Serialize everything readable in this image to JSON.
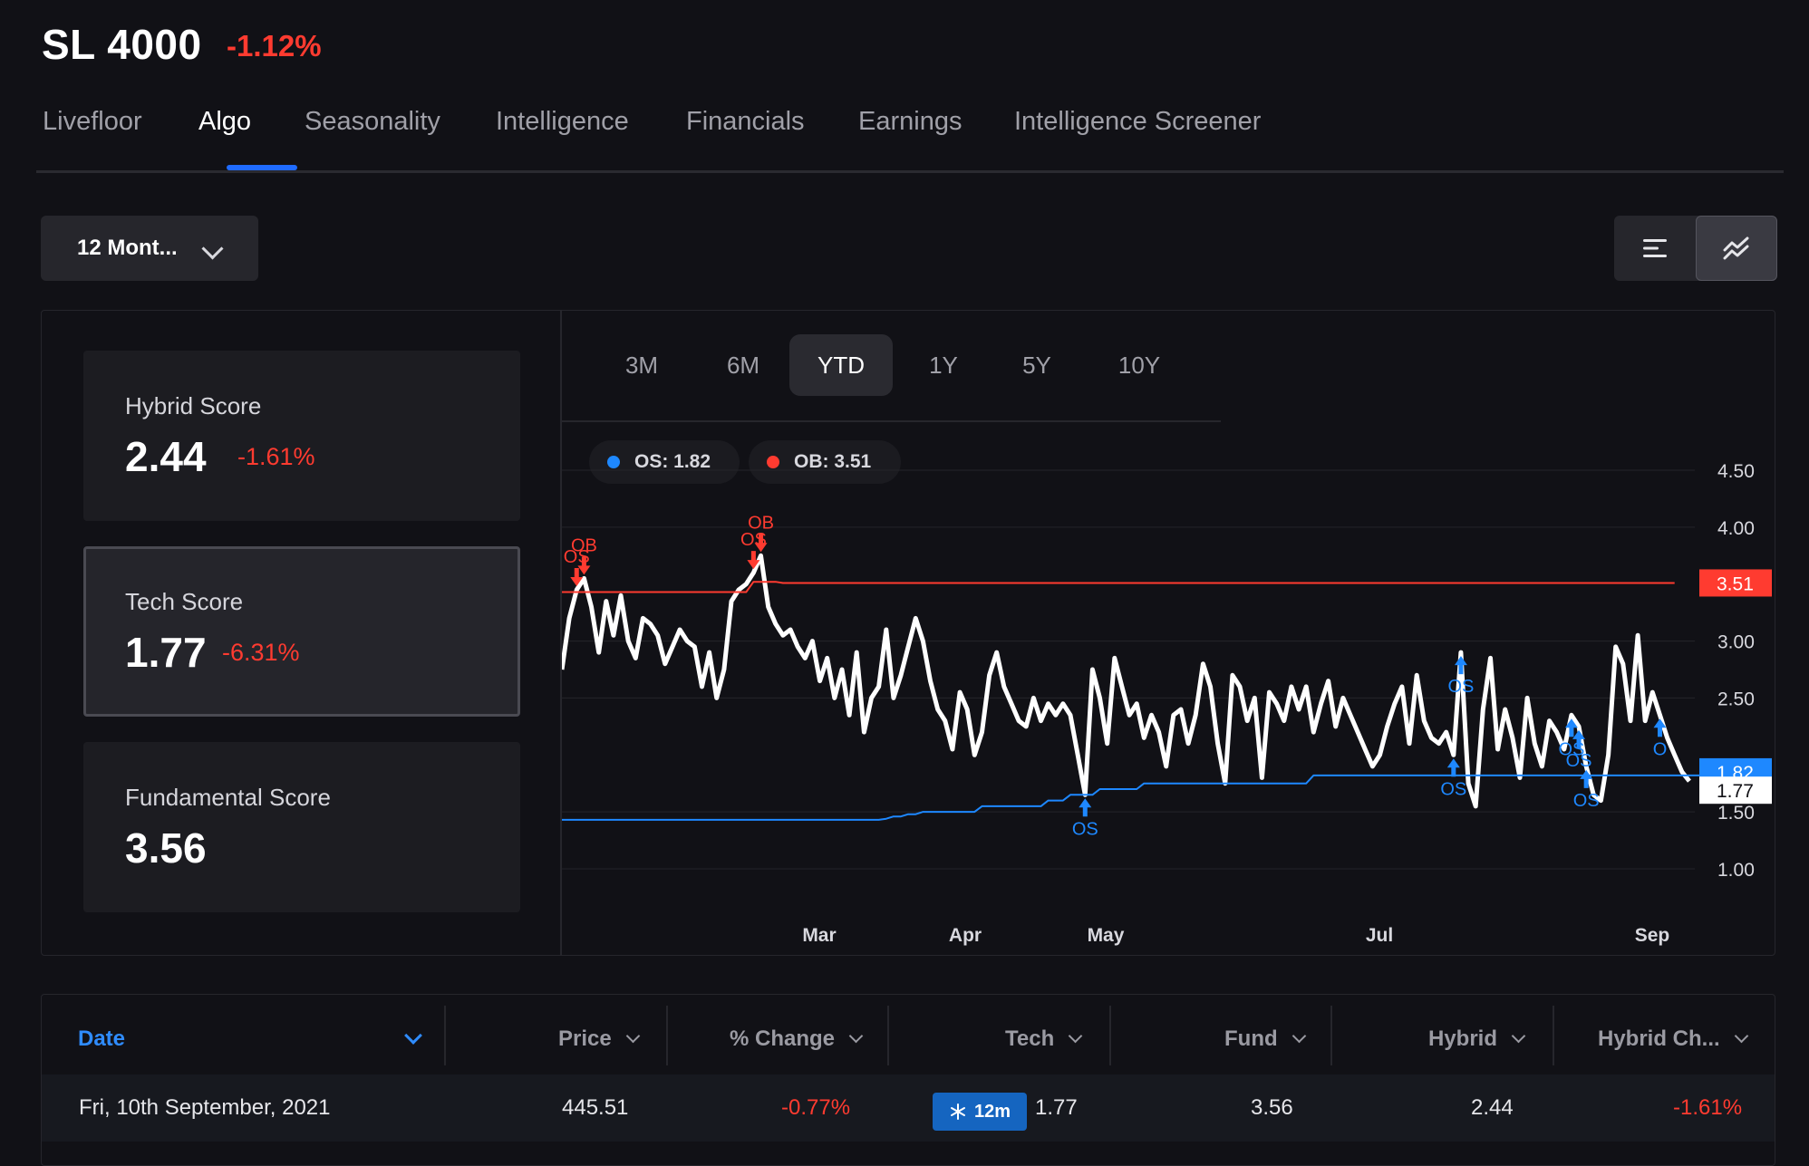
{
  "header": {
    "ticker": "SL 4000",
    "change": "-1.12%"
  },
  "tabs": [
    "Livefloor",
    "Algo",
    "Seasonality",
    "Intelligence",
    "Financials",
    "Earnings",
    "Intelligence Screener"
  ],
  "active_tab": "Algo",
  "period_select": {
    "value": "12 Mont..."
  },
  "view_toggle": {
    "icons": [
      "list-icon",
      "trend-chart-icon"
    ],
    "active": "trend-chart-icon"
  },
  "scores": [
    {
      "label": "Hybrid Score",
      "value": "2.44",
      "change": "-1.61%"
    },
    {
      "label": "Tech Score",
      "value": "1.77",
      "change": "-6.31%"
    },
    {
      "label": "Fundamental Score",
      "value": "3.56",
      "change": ""
    }
  ],
  "range_tabs": [
    "3M",
    "6M",
    "YTD",
    "1Y",
    "5Y",
    "10Y"
  ],
  "active_range": "YTD",
  "legend": [
    {
      "label": "OS: 1.82",
      "color": "#1e88ff"
    },
    {
      "label": "OB: 3.51",
      "color": "#ff3b30"
    }
  ],
  "chart_data": {
    "type": "line",
    "x_ticks": [
      "Mar",
      "Apr",
      "May",
      "Jul",
      "Sep"
    ],
    "y_ticks": [
      "4.50",
      "4.00",
      "3.00",
      "2.50",
      "1.50",
      "1.00"
    ],
    "ylim": [
      0.8,
      4.7
    ],
    "grid": true,
    "series": [
      {
        "role": "score",
        "color": "#ffffff",
        "values": [
          2.75,
          3.2,
          3.45,
          3.55,
          3.3,
          2.9,
          3.35,
          3.05,
          3.4,
          3.0,
          2.85,
          3.2,
          3.15,
          3.05,
          2.8,
          2.95,
          3.1,
          3.0,
          2.95,
          2.6,
          2.9,
          2.5,
          2.75,
          3.35,
          3.45,
          3.5,
          3.6,
          3.75,
          3.3,
          3.15,
          3.05,
          3.1,
          2.95,
          2.85,
          3.0,
          2.65,
          2.85,
          2.5,
          2.75,
          2.35,
          2.9,
          2.2,
          2.5,
          2.6,
          3.1,
          2.5,
          2.7,
          2.95,
          3.2,
          3.0,
          2.65,
          2.4,
          2.3,
          2.05,
          2.55,
          2.4,
          2.0,
          2.2,
          2.7,
          2.9,
          2.6,
          2.45,
          2.3,
          2.25,
          2.5,
          2.3,
          2.45,
          2.35,
          2.45,
          2.35,
          2.0,
          1.65,
          2.75,
          2.5,
          2.1,
          2.85,
          2.6,
          2.35,
          2.45,
          2.15,
          2.35,
          2.2,
          1.9,
          2.35,
          2.4,
          2.1,
          2.35,
          2.8,
          2.6,
          2.1,
          1.75,
          2.7,
          2.6,
          2.3,
          2.5,
          1.8,
          2.55,
          2.45,
          2.3,
          2.6,
          2.4,
          2.6,
          2.2,
          2.45,
          2.65,
          2.25,
          2.5,
          2.35,
          2.2,
          2.05,
          1.9,
          2.0,
          2.25,
          2.45,
          2.6,
          2.1,
          2.7,
          2.3,
          2.15,
          2.1,
          2.2,
          2.0,
          2.9,
          1.75,
          1.55,
          2.4,
          2.85,
          2.05,
          2.4,
          2.15,
          1.8,
          2.5,
          2.1,
          1.9,
          2.3,
          2.2,
          2.05,
          2.35,
          2.25,
          1.9,
          1.65,
          1.6,
          2.0,
          2.95,
          2.8,
          2.3,
          3.05,
          2.3,
          2.55,
          2.35,
          2.15,
          2.0,
          1.85,
          1.77
        ]
      },
      {
        "role": "overbought-threshold",
        "color": "#ff3b30",
        "values": [
          3.43,
          3.43,
          3.43,
          3.43,
          3.43,
          3.43,
          3.43,
          3.43,
          3.43,
          3.43,
          3.43,
          3.43,
          3.43,
          3.43,
          3.43,
          3.43,
          3.43,
          3.43,
          3.43,
          3.43,
          3.43,
          3.43,
          3.43,
          3.43,
          3.43,
          3.43,
          3.52,
          3.52,
          3.52,
          3.52,
          3.51,
          3.51,
          3.51,
          3.51,
          3.51,
          3.51,
          3.51,
          3.51,
          3.51,
          3.51,
          3.51,
          3.51,
          3.51,
          3.51,
          3.51,
          3.51,
          3.51,
          3.51,
          3.51,
          3.51,
          3.51,
          3.51,
          3.51,
          3.51,
          3.51,
          3.51,
          3.51,
          3.51,
          3.51,
          3.51,
          3.51,
          3.51,
          3.51,
          3.51,
          3.51,
          3.51,
          3.51,
          3.51,
          3.51,
          3.51,
          3.51,
          3.51,
          3.51,
          3.51,
          3.51,
          3.51,
          3.51,
          3.51,
          3.51,
          3.51,
          3.51,
          3.51,
          3.51,
          3.51,
          3.51,
          3.51,
          3.51,
          3.51,
          3.51,
          3.51,
          3.51,
          3.51,
          3.51,
          3.51,
          3.51,
          3.51,
          3.51,
          3.51,
          3.51,
          3.51,
          3.51,
          3.51,
          3.51,
          3.51,
          3.51,
          3.51,
          3.51,
          3.51,
          3.51,
          3.51,
          3.51,
          3.51,
          3.51,
          3.51,
          3.51,
          3.51,
          3.51,
          3.51,
          3.51,
          3.51,
          3.51,
          3.51,
          3.51,
          3.51,
          3.51,
          3.51,
          3.51,
          3.51,
          3.51,
          3.51,
          3.51,
          3.51,
          3.51,
          3.51,
          3.51,
          3.51,
          3.51,
          3.51,
          3.51,
          3.51,
          3.51,
          3.51,
          3.51,
          3.51,
          3.51,
          3.51,
          3.51,
          3.51,
          3.51,
          3.51,
          3.51,
          3.51
        ]
      },
      {
        "role": "oversold-threshold",
        "color": "#1e88ff",
        "values": [
          1.43,
          1.43,
          1.43,
          1.43,
          1.43,
          1.43,
          1.43,
          1.43,
          1.43,
          1.43,
          1.43,
          1.43,
          1.43,
          1.43,
          1.43,
          1.43,
          1.43,
          1.43,
          1.43,
          1.43,
          1.43,
          1.43,
          1.43,
          1.43,
          1.43,
          1.43,
          1.43,
          1.43,
          1.43,
          1.43,
          1.43,
          1.43,
          1.43,
          1.43,
          1.43,
          1.43,
          1.43,
          1.43,
          1.43,
          1.43,
          1.43,
          1.43,
          1.43,
          1.43,
          1.44,
          1.46,
          1.46,
          1.48,
          1.48,
          1.5,
          1.5,
          1.5,
          1.5,
          1.5,
          1.5,
          1.5,
          1.5,
          1.55,
          1.55,
          1.55,
          1.55,
          1.55,
          1.55,
          1.55,
          1.55,
          1.55,
          1.6,
          1.6,
          1.6,
          1.65,
          1.65,
          1.65,
          1.65,
          1.7,
          1.7,
          1.7,
          1.7,
          1.7,
          1.7,
          1.75,
          1.75,
          1.75,
          1.75,
          1.75,
          1.75,
          1.75,
          1.75,
          1.75,
          1.75,
          1.75,
          1.75,
          1.75,
          1.75,
          1.75,
          1.75,
          1.75,
          1.75,
          1.75,
          1.75,
          1.75,
          1.75,
          1.75,
          1.82,
          1.82,
          1.82,
          1.82,
          1.82,
          1.82,
          1.82,
          1.82,
          1.82,
          1.82,
          1.82,
          1.82,
          1.82,
          1.82,
          1.82,
          1.82,
          1.82,
          1.82,
          1.82,
          1.82,
          1.82,
          1.82,
          1.82,
          1.82,
          1.82,
          1.82,
          1.82,
          1.82,
          1.82,
          1.82,
          1.82,
          1.82,
          1.82,
          1.82,
          1.82,
          1.82,
          1.82,
          1.82,
          1.82,
          1.82,
          1.82,
          1.82,
          1.82,
          1.82,
          1.82,
          1.82,
          1.82,
          1.82,
          1.82,
          1.82,
          1.82,
          1.82,
          1.82,
          1.82,
          1.82,
          1.82,
          1.82,
          1.82,
          1.82,
          1.82,
          1.82
        ]
      }
    ],
    "value_tags": [
      {
        "value": "3.51",
        "color": "#ff3b30"
      },
      {
        "value": "1.82",
        "color": "#1e88ff"
      },
      {
        "value": "1.77",
        "color": "#ffffff"
      }
    ],
    "signals": [
      {
        "label": "OB",
        "index": 3,
        "type": "overbought"
      },
      {
        "label": "OS",
        "index": 2,
        "type": "overbought"
      },
      {
        "label": "OB",
        "index": 27,
        "type": "overbought"
      },
      {
        "label": "OS",
        "index": 26,
        "type": "overbought"
      },
      {
        "label": "OS",
        "index": 71,
        "type": "oversold"
      },
      {
        "label": "OS",
        "index": 121,
        "type": "oversold"
      },
      {
        "label": "OS",
        "index": 122,
        "type": "oversold"
      },
      {
        "label": "OS",
        "index": 137,
        "type": "oversold"
      },
      {
        "label": "OS",
        "index": 138,
        "type": "oversold"
      },
      {
        "label": "OS",
        "index": 139,
        "type": "oversold"
      },
      {
        "label": "O",
        "index": 149,
        "type": "oversold"
      }
    ]
  },
  "table": {
    "columns": [
      "Date",
      "Price",
      "% Change",
      "Tech",
      "Fund",
      "Hybrid",
      "Hybrid Ch..."
    ],
    "rows": [
      {
        "date": "Fri, 10th September, 2021",
        "price": "445.51",
        "change": "-0.77%",
        "badge": "12m",
        "tech": "1.77",
        "fund": "3.56",
        "hybrid": "2.44",
        "hybrid_change": "-1.61%"
      }
    ]
  }
}
